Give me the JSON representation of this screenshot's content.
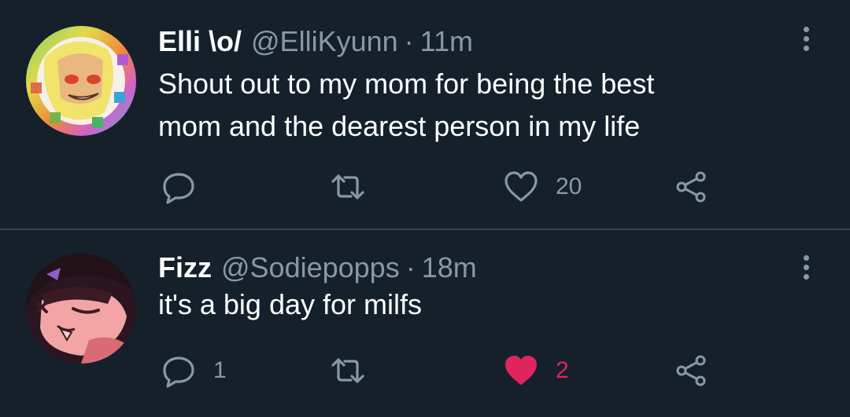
{
  "tweets": [
    {
      "display_name": "Elli \\o/",
      "handle": "@ElliKyunn",
      "separator": "·",
      "time": "11m",
      "text": "Shout out to my mom for being the best\nmom and the dearest person in my life",
      "reply_count": "",
      "retweet_count": "",
      "like_count": "20",
      "liked": false,
      "avatar_icon": "anime-avatar"
    },
    {
      "display_name": "Fizz",
      "handle": "@Sodiepopps",
      "separator": "·",
      "time": "18m",
      "text": "it's a big day for milfs",
      "reply_count": "1",
      "retweet_count": "",
      "like_count": "2",
      "liked": true,
      "avatar_icon": "cartoon-avatar"
    }
  ],
  "colors": {
    "background": "#15202b",
    "secondary_text": "#8899a6",
    "like_active": "#e0245e",
    "divider": "#38444d"
  },
  "icons": {
    "reply": "reply-icon",
    "retweet": "retweet-icon",
    "like": "heart-icon",
    "share": "share-icon",
    "more": "more-vertical-icon"
  }
}
